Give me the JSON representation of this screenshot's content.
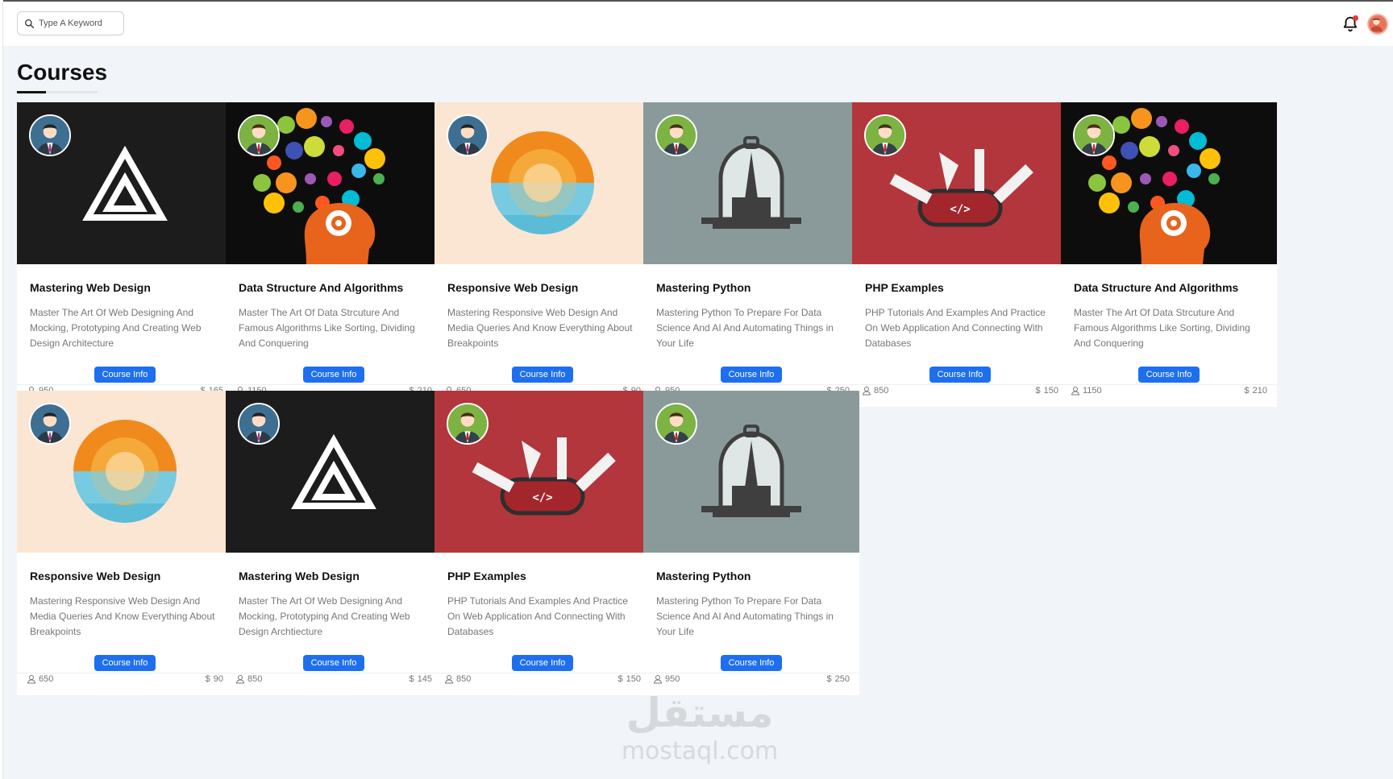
{
  "header": {
    "search_placeholder": "Type A Keyword"
  },
  "page": {
    "title": "Courses"
  },
  "colors": {
    "accent": "#1e6ff0",
    "dark_bg": "#1c1c1c",
    "cream_bg": "#fbe6d3",
    "gray_bg": "#8a9a9b",
    "red_bg": "#b3363c"
  },
  "card_labels": {
    "button": "Course Info",
    "currency": "$"
  },
  "courses": [
    {
      "title": "Mastering Web Design",
      "desc": "Master The Art Of Web Designing And Mocking, Prototyping And Creating Web Design Architecture",
      "students": "950",
      "price": "165",
      "theme": "a-logo",
      "author": "blue"
    },
    {
      "title": "Data Structure And Algorithms",
      "desc": "Master The Art Of Data Strcuture And Famous Algorithms Like Sorting, Dividing And Conquering",
      "students": "1150",
      "price": "210",
      "theme": "brain",
      "author": "green"
    },
    {
      "title": "Responsive Web Design",
      "desc": "Mastering Responsive Web Design And Media Queries And Know Everything About Breakpoints",
      "students": "650",
      "price": "90",
      "theme": "sun",
      "author": "blue"
    },
    {
      "title": "Mastering Python",
      "desc": "Mastering Python To Prepare For Data Science And AI And Automating Things in Your Life",
      "students": "950",
      "price": "250",
      "theme": "dome",
      "author": "green"
    },
    {
      "title": "PHP Examples",
      "desc": "PHP Tutorials And Examples And Practice On Web Application And Connecting With Databases",
      "students": "850",
      "price": "150",
      "theme": "knife",
      "author": "green"
    },
    {
      "title": "Data Structure And Algorithms",
      "desc": "Master The Art Of Data Strcuture And Famous Algorithms Like Sorting, Dividing And Conquering",
      "students": "1150",
      "price": "210",
      "theme": "brain",
      "author": "green"
    },
    {
      "title": "Responsive Web Design",
      "desc": "Mastering Responsive Web Design And Media Queries And Know Everything About Breakpoints",
      "students": "650",
      "price": "90",
      "theme": "sun",
      "author": "blue"
    },
    {
      "title": "Mastering Web Design",
      "desc": "Master The Art Of Web Designing And Mocking, Prototyping And Creating Web Design Archtiecture",
      "students": "850",
      "price": "145",
      "theme": "a-logo",
      "author": "blue"
    },
    {
      "title": "PHP Examples",
      "desc": "PHP Tutorials And Examples And Practice On Web Application And Connecting With Databases",
      "students": "850",
      "price": "150",
      "theme": "knife",
      "author": "green"
    },
    {
      "title": "Mastering Python",
      "desc": "Mastering Python To Prepare For Data Science And AI And Automating Things in Your Life",
      "students": "950",
      "price": "250",
      "theme": "dome",
      "author": "green"
    }
  ],
  "watermark": {
    "arabic": "مستقل",
    "latin": "mostaql.com"
  }
}
